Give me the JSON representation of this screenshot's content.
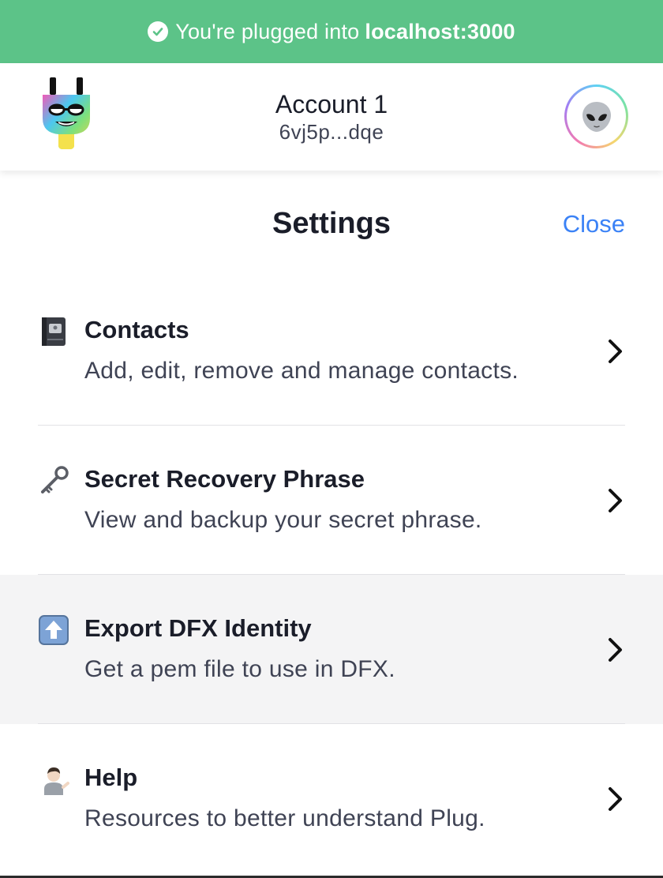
{
  "banner": {
    "text": "You're plugged into",
    "host": "localhost:3000",
    "color": "#5cc388"
  },
  "header": {
    "account_name": "Account 1",
    "account_id": "6vj5p...dqe",
    "avatar_icon": "alien-emoji-icon",
    "logo_icon": "plug-logo-icon"
  },
  "settings": {
    "title": "Settings",
    "close_label": "Close",
    "accent_color": "#3b82f6"
  },
  "menu": {
    "items": [
      {
        "icon": "address-book-icon",
        "title": "Contacts",
        "description": "Add, edit, remove and manage contacts."
      },
      {
        "icon": "key-icon",
        "title": "Secret Recovery Phrase",
        "description": "View and backup your secret phrase."
      },
      {
        "icon": "up-arrow-button-icon",
        "title": "Export DFX Identity",
        "description": "Get a pem file to use in DFX."
      },
      {
        "icon": "person-shrugging-icon",
        "title": "Help",
        "description": "Resources to better understand Plug."
      }
    ]
  }
}
